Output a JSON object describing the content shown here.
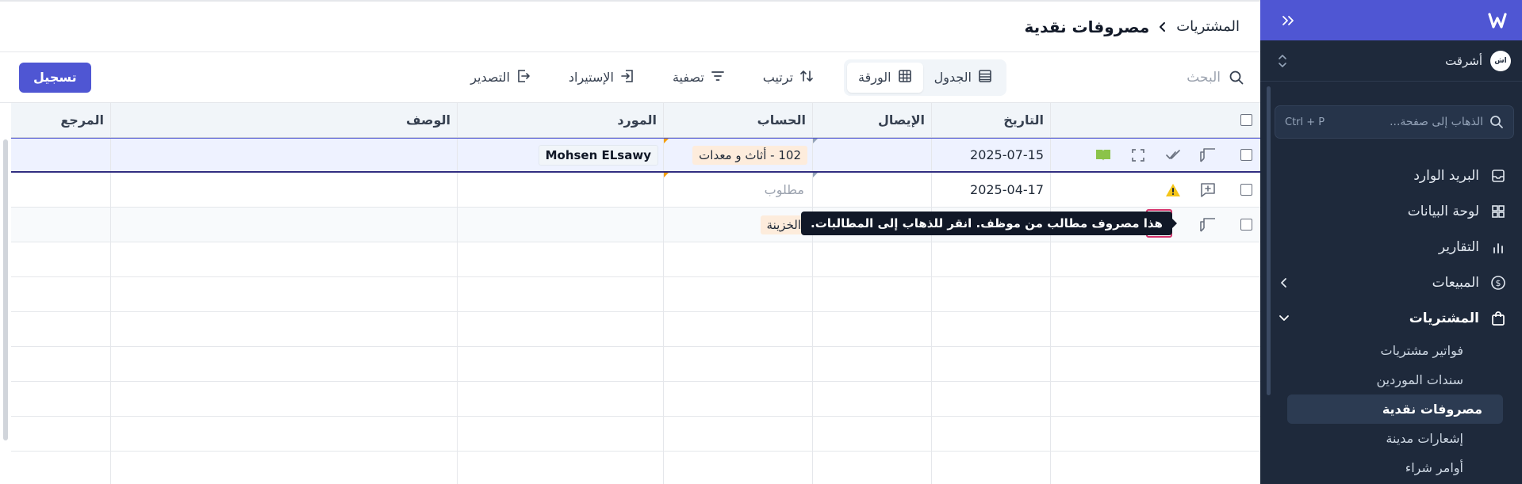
{
  "sidebar": {
    "org_name": "أشرقت",
    "org_avatar": "اش",
    "goto_placeholder": "الذهاب إلى صفحة...",
    "goto_shortcut": "Ctrl + P",
    "items": [
      {
        "label": "البريد الوارد",
        "icon": "inbox-icon"
      },
      {
        "label": "لوحة البيانات",
        "icon": "dashboard-icon"
      },
      {
        "label": "التقارير",
        "icon": "reports-icon"
      },
      {
        "label": "المبيعات",
        "icon": "dollar-icon"
      },
      {
        "label": "المشتريات",
        "icon": "shopping-bag-icon"
      }
    ],
    "sub_items": [
      {
        "label": "فواتير مشتريات"
      },
      {
        "label": "سندات الموردين"
      },
      {
        "label": "مصروفات نقدية"
      },
      {
        "label": "إشعارات مدينة"
      },
      {
        "label": "أوامر شراء"
      }
    ]
  },
  "breadcrumb": {
    "parent": "المشتريات",
    "current": "مصروفات نقدية"
  },
  "toolbar": {
    "search_placeholder": "البحث",
    "view_table": "الجدول",
    "view_sheet": "الورقة",
    "sort": "ترتيب",
    "filter": "تصفية",
    "import": "الإستيراد",
    "export": "التصدير",
    "submit": "تسجيل"
  },
  "table": {
    "columns": [
      "التاريخ",
      "الإيصال",
      "الحساب",
      "المورد",
      "الوصف",
      "المرجع"
    ],
    "rows": [
      {
        "date": "2025-07-15",
        "receipt": "",
        "account": "102 - أثاث و معدات",
        "vendor": "Mohsen ELsawy",
        "description": "",
        "reference": ""
      },
      {
        "date": "2025-04-17",
        "receipt": "",
        "account": "مطلوب",
        "vendor": "",
        "description": "",
        "reference": ""
      },
      {
        "date": "",
        "receipt": "",
        "account": "الخزينة",
        "vendor": "",
        "description": "",
        "reference": ""
      }
    ]
  },
  "tooltip": "هذا مصروف مطالب من موظف. انقر للذهاب إلى المطالبات.",
  "colors": {
    "brand": "#4f56d3",
    "sidebar_bg": "#1e293b",
    "tag_bg": "#fdecdc",
    "warning": "#f5c518",
    "claim": "#16a34a"
  }
}
